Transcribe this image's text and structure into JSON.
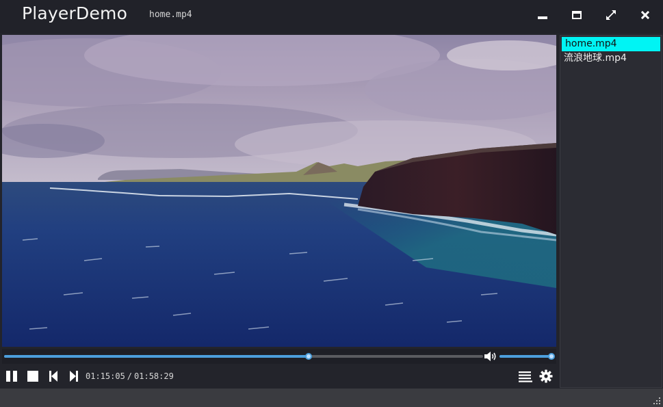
{
  "window": {
    "app_title": "PlayerDemo",
    "current_file": "home.mp4",
    "buttons": {
      "minimize_icon": "minimize-icon",
      "maximize_icon": "maximize-icon",
      "fullscreen_icon": "fullscreen-icon",
      "close_icon": "close-icon"
    }
  },
  "player": {
    "progress_fraction": 0.636,
    "volume_fraction": 1.0,
    "current_time": "01:15:05",
    "separator": "/",
    "total_time": "01:58:29",
    "controls": [
      "pause",
      "stop",
      "previous",
      "next"
    ],
    "right_controls": [
      "playlist",
      "settings"
    ]
  },
  "playlist": {
    "items": [
      {
        "label": "home.mp4",
        "selected": true
      },
      {
        "label": "流浪地球.mp4",
        "selected": false
      }
    ]
  },
  "colors": {
    "accent": "#4c9fdc",
    "selection": "#00f4f4",
    "titlebar": "#212229",
    "statusbar": "#3a3b40"
  }
}
